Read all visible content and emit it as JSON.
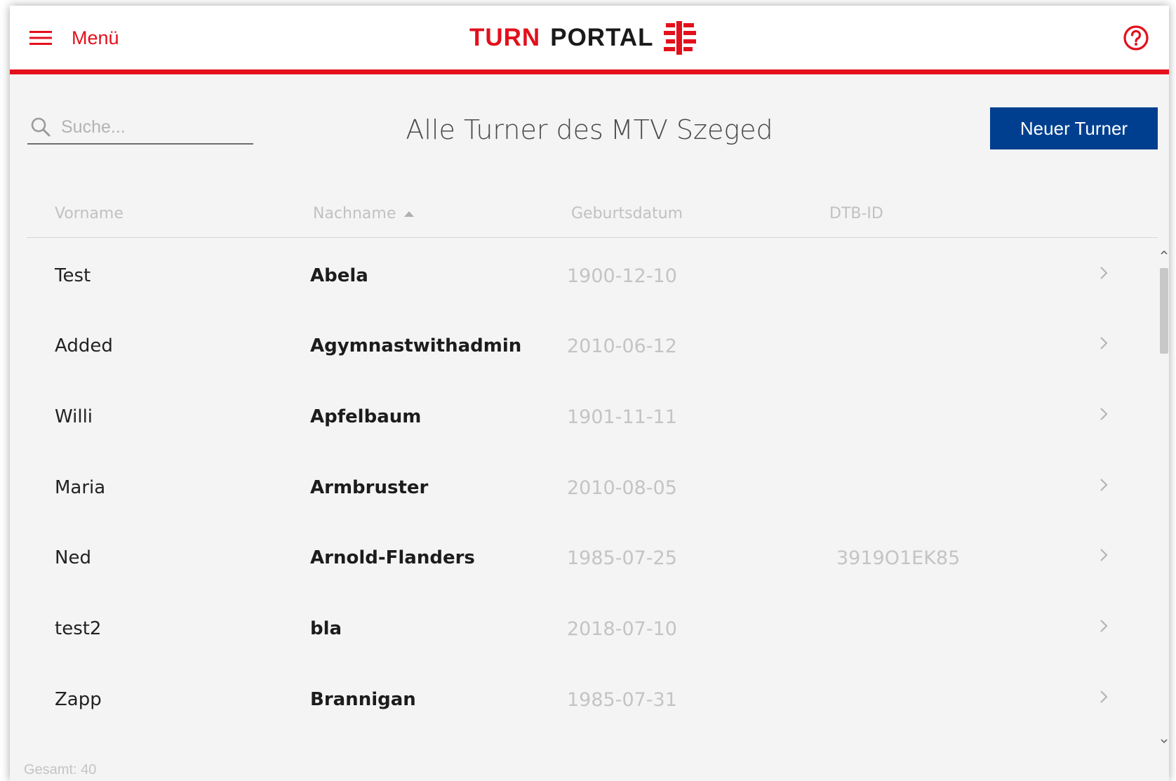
{
  "header": {
    "menu_label": "Menü",
    "brand_turn": "TURN",
    "brand_portal": "PORTAL",
    "accent_color": "#e3101b"
  },
  "toolbar": {
    "search_placeholder": "Suche...",
    "title_part1": "Alle Turner des",
    "title_part2": "MTV Szeged",
    "new_button_label": "Neuer Turner",
    "button_color": "#003f8f"
  },
  "table": {
    "columns": {
      "vorname": "Vorname",
      "nachname": "Nachname",
      "geburtsdatum": "Geburtsdatum",
      "dtb_id": "DTB-ID"
    },
    "sorted_by": "Nachname",
    "sort_direction": "ascending",
    "rows": [
      {
        "vorname": "Test",
        "nachname": "Abela",
        "geburtsdatum": "1900-12-10",
        "dtb_id": ""
      },
      {
        "vorname": "Added",
        "nachname": "Agymnastwithadmin",
        "geburtsdatum": "2010-06-12",
        "dtb_id": ""
      },
      {
        "vorname": "Willi",
        "nachname": "Apfelbaum",
        "geburtsdatum": "1901-11-11",
        "dtb_id": ""
      },
      {
        "vorname": "Maria",
        "nachname": "Armbruster",
        "geburtsdatum": "2010-08-05",
        "dtb_id": ""
      },
      {
        "vorname": "Ned",
        "nachname": "Arnold-Flanders",
        "geburtsdatum": "1985-07-25",
        "dtb_id": "3919O1EK85"
      },
      {
        "vorname": "test2",
        "nachname": "bla",
        "geburtsdatum": "2018-07-10",
        "dtb_id": ""
      },
      {
        "vorname": "Zapp",
        "nachname": "Brannigan",
        "geburtsdatum": "1985-07-31",
        "dtb_id": ""
      }
    ]
  },
  "footer": {
    "total_label": "Gesamt: 40"
  }
}
